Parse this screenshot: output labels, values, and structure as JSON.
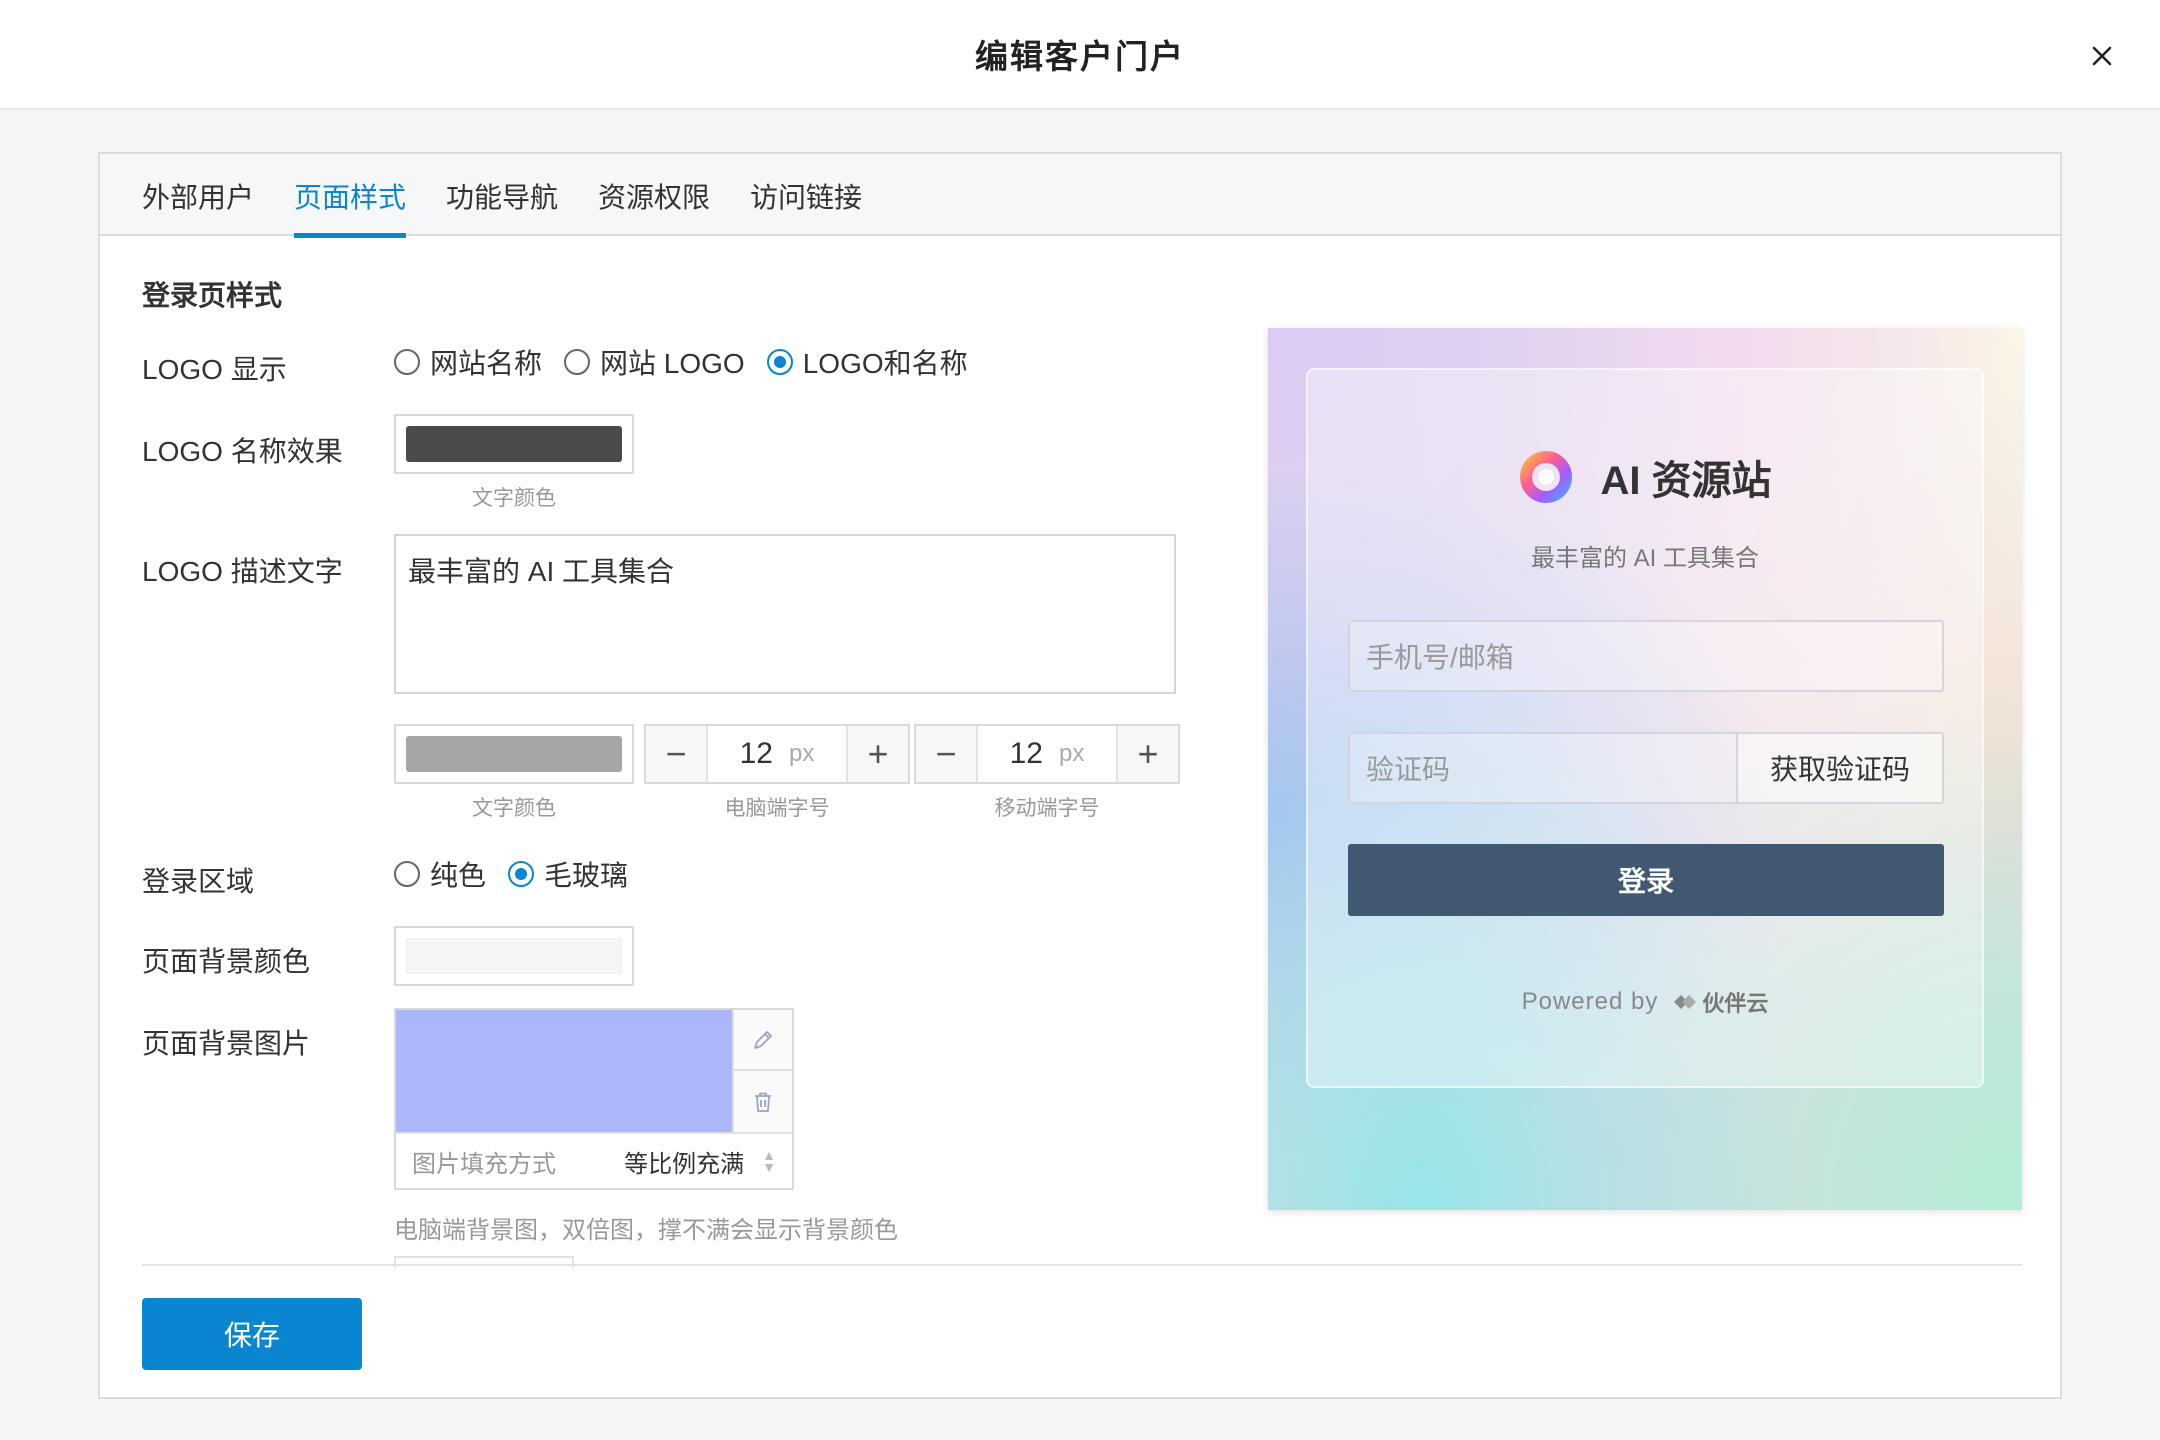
{
  "header": {
    "title": "编辑客户门户"
  },
  "tabs": [
    {
      "label": "外部用户"
    },
    {
      "label": "页面样式"
    },
    {
      "label": "功能导航"
    },
    {
      "label": "资源权限"
    },
    {
      "label": "访问链接"
    }
  ],
  "active_tab": "页面样式",
  "form": {
    "section_title": "登录页样式",
    "logo_display": {
      "label": "LOGO 显示",
      "options": [
        "网站名称",
        "网站 LOGO",
        "LOGO和名称"
      ],
      "selected": "LOGO和名称"
    },
    "logo_name_effect": {
      "label": "LOGO 名称效果",
      "color": "#4a4a4a",
      "color_caption": "文字颜色"
    },
    "logo_desc": {
      "label": "LOGO 描述文字",
      "value": "最丰富的 AI 工具集合",
      "color": "#a6a6a6",
      "color_caption": "文字颜色",
      "pc_size": {
        "value": "12",
        "unit": "px",
        "caption": "电脑端字号"
      },
      "mobile_size": {
        "value": "12",
        "unit": "px",
        "caption": "移动端字号"
      }
    },
    "login_area": {
      "label": "登录区域",
      "options": [
        "纯色",
        "毛玻璃"
      ],
      "selected": "毛玻璃"
    },
    "page_bg_color": {
      "label": "页面背景颜色",
      "color": "#f5f5f5"
    },
    "page_bg_image": {
      "label": "页面背景图片",
      "preview_color": "#abb6fb",
      "fill_label": "图片填充方式",
      "fill_value": "等比例充满",
      "hint": "电脑端背景图，双倍图，撑不满会显示背景颜色"
    },
    "save_label": "保存"
  },
  "preview": {
    "site_name": "AI 资源站",
    "site_desc": "最丰富的 AI 工具集合",
    "account_placeholder": "手机号/邮箱",
    "code_placeholder": "验证码",
    "get_code_label": "获取验证码",
    "login_label": "登录",
    "powered_by": "Powered by",
    "partner_name": "伙伴云",
    "login_button_color": "#415873"
  },
  "accent_color": "#0a86d1"
}
